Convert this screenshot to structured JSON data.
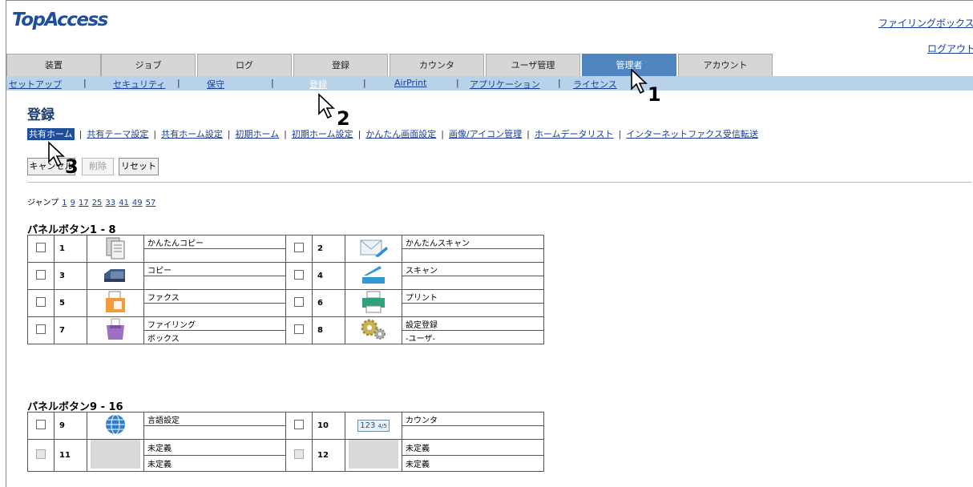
{
  "app": {
    "logo": "TopAccess"
  },
  "header": {
    "filing_box_link": "ファイリングボックス",
    "logout_link": "ログアウト"
  },
  "tabs": [
    "装置",
    "ジョブ",
    "ログ",
    "登録",
    "カウンタ",
    "ユーザ管理",
    "管理者",
    "アカウント"
  ],
  "active_tab": "管理者",
  "subnav": [
    "セットアップ",
    "セキュリティ",
    "保守",
    "登録",
    "AirPrint",
    "アプリケーション",
    "ライセンス"
  ],
  "active_subnav": "登録",
  "page": {
    "title": "登録"
  },
  "sublinks": [
    "共有ホーム",
    "共有テーマ設定",
    "共有ホーム設定",
    "初期ホーム",
    "初期ホーム設定",
    "かんたん画面設定",
    "画像/アイコン管理",
    "ホームデータリスト",
    "インターネットファクス受信転送"
  ],
  "active_sublink": "共有ホーム",
  "buttons": {
    "cancel": "キャンセル",
    "delete": "削除",
    "reset": "リセット"
  },
  "jump": {
    "label": "ジャンプ",
    "pages": [
      "1",
      "9",
      "17",
      "25",
      "33",
      "41",
      "49",
      "57"
    ]
  },
  "sections": [
    {
      "title": "パネルボタン1 - 8",
      "rows": [
        [
          {
            "num": "1",
            "icon": "copy-icon",
            "line1": "かんたんコピー",
            "line2": ""
          },
          {
            "num": "2",
            "icon": "scan-envelope-icon",
            "line1": "かんたんスキャン",
            "line2": ""
          }
        ],
        [
          {
            "num": "3",
            "icon": "copier-icon",
            "line1": "コピー",
            "line2": ""
          },
          {
            "num": "4",
            "icon": "scanner-icon",
            "line1": "スキャン",
            "line2": ""
          }
        ],
        [
          {
            "num": "5",
            "icon": "fax-icon",
            "line1": "ファクス",
            "line2": ""
          },
          {
            "num": "6",
            "icon": "printer-icon",
            "line1": "プリント",
            "line2": ""
          }
        ],
        [
          {
            "num": "7",
            "icon": "filing-box-icon",
            "line1": "ファイリング",
            "line2": "ボックス"
          },
          {
            "num": "8",
            "icon": "gears-icon",
            "line1": "設定登録",
            "line2": "-ユーザ-"
          }
        ]
      ]
    },
    {
      "title": "パネルボタン9 - 16",
      "rows": [
        [
          {
            "num": "9",
            "icon": "globe-icon",
            "line1": "言語設定",
            "line2": ""
          },
          {
            "num": "10",
            "icon": "counter-icon",
            "line1": "カウンタ",
            "line2": ""
          }
        ],
        [
          {
            "num": "11",
            "icon": "blank-icon",
            "line1": "未定義",
            "line2": "未定義"
          },
          {
            "num": "12",
            "icon": "blank-icon",
            "line1": "未定義",
            "line2": "未定義"
          }
        ]
      ]
    }
  ],
  "callouts": [
    "1",
    "2",
    "3"
  ],
  "counter_icon_text": "123",
  "counter_icon_frac": "4/5"
}
